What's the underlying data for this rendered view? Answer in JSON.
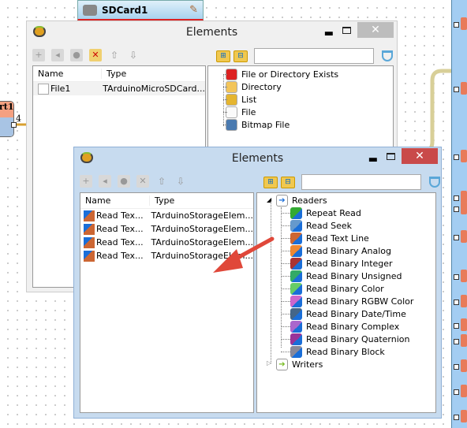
{
  "component": {
    "title": "SDCard1"
  },
  "left_component": {
    "label": "rt1",
    "pin_label": "4"
  },
  "back_window": {
    "title": "Elements",
    "list": {
      "headers": [
        "Name",
        "Type"
      ],
      "rows": [
        {
          "name": "File1",
          "type": "TArduinoMicroSDCard..."
        }
      ]
    },
    "tree": [
      {
        "label": "File or Directory Exists",
        "icon": "question-magnifier-icon"
      },
      {
        "label": "Directory",
        "icon": "folder-icon"
      },
      {
        "label": "List",
        "icon": "folder-search-icon"
      },
      {
        "label": "File",
        "icon": "file-icon"
      },
      {
        "label": "Bitmap File",
        "icon": "bitmap-icon"
      }
    ]
  },
  "front_window": {
    "title": "Elements",
    "list": {
      "headers": [
        "Name",
        "Type"
      ],
      "rows": [
        {
          "name": "Read Tex...",
          "type": "TArduinoStorageElem..."
        },
        {
          "name": "Read Tex...",
          "type": "TArduinoStorageElem..."
        },
        {
          "name": "Read Tex...",
          "type": "TArduinoStorageElem..."
        },
        {
          "name": "Read Tex...",
          "type": "TArduinoStorageElem..."
        }
      ]
    },
    "tree": {
      "readers": {
        "label": "Readers",
        "expanded": true
      },
      "reader_items": [
        {
          "label": "Repeat Read",
          "color": "#3a3"
        },
        {
          "label": "Read Seek",
          "color": "#69c"
        },
        {
          "label": "Read Text Line",
          "color": "#c63"
        },
        {
          "label": "Read Binary Analog",
          "color": "#e83"
        },
        {
          "label": "Read Binary Integer",
          "color": "#a33"
        },
        {
          "label": "Read Binary Unsigned",
          "color": "#3a6"
        },
        {
          "label": "Read Binary Color",
          "color": "#6c6"
        },
        {
          "label": "Read Binary RGBW Color",
          "color": "#c6c"
        },
        {
          "label": "Read Binary Date/Time",
          "color": "#468"
        },
        {
          "label": "Read Binary Complex",
          "color": "#a6c"
        },
        {
          "label": "Read Binary Quaternion",
          "color": "#939"
        },
        {
          "label": "Read Binary Block",
          "color": "#889"
        }
      ],
      "writers": {
        "label": "Writers",
        "expanded": false
      }
    }
  },
  "colors": {
    "close_active": "#c94a4a",
    "arrow": "#e0483a",
    "titlebar_active": "#c7dbef"
  }
}
